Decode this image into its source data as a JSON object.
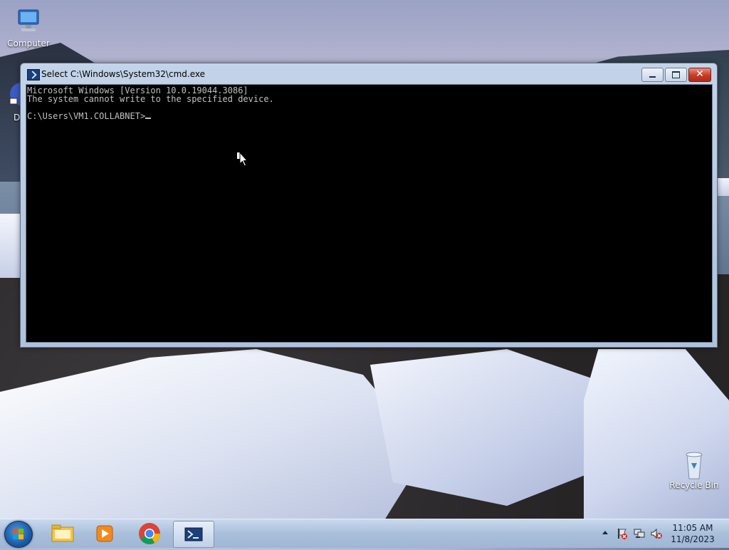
{
  "desktop": {
    "icons": [
      {
        "label": "Computer"
      },
      {
        "label": "D"
      },
      {
        "label": "Recycle Bin"
      }
    ]
  },
  "cmd_window": {
    "title": "Select C:\\Windows\\System32\\cmd.exe",
    "lines": [
      "Microsoft Windows [Version 10.0.19044.3086]",
      "The system cannot write to the specified device.",
      "",
      "C:\\Users\\VM1.COLLABNET>"
    ],
    "buttons": {
      "minimize": "minimize-icon",
      "maximize": "maximize-icon",
      "close": "close-icon"
    }
  },
  "taskbar": {
    "start_icon": "windows-start-icon",
    "pinned": [
      {
        "name": "file-explorer-icon"
      },
      {
        "name": "media-player-icon"
      },
      {
        "name": "chrome-icon"
      },
      {
        "name": "cmd-icon",
        "active": true
      }
    ],
    "clock": {
      "time": "11:05 AM",
      "date": "11/8/2023"
    }
  }
}
